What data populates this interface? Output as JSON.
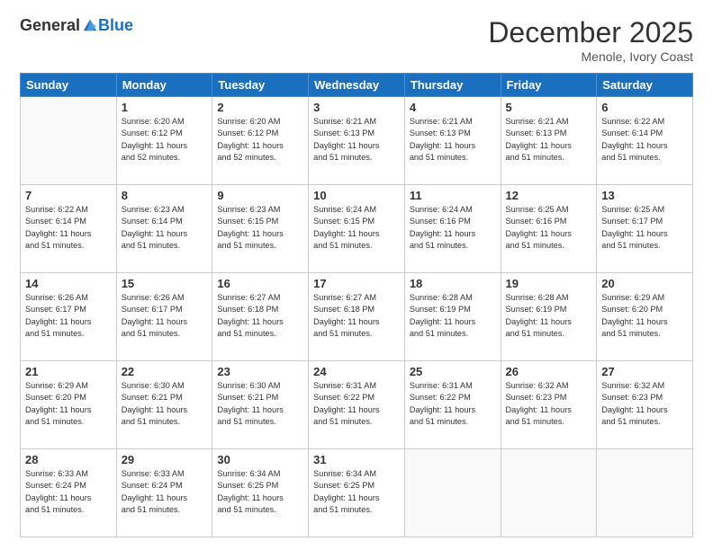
{
  "logo": {
    "general": "General",
    "blue": "Blue"
  },
  "header": {
    "month": "December 2025",
    "location": "Menole, Ivory Coast"
  },
  "weekdays": [
    "Sunday",
    "Monday",
    "Tuesday",
    "Wednesday",
    "Thursday",
    "Friday",
    "Saturday"
  ],
  "weeks": [
    [
      {
        "day": "",
        "info": ""
      },
      {
        "day": "1",
        "info": "Sunrise: 6:20 AM\nSunset: 6:12 PM\nDaylight: 11 hours\nand 52 minutes."
      },
      {
        "day": "2",
        "info": "Sunrise: 6:20 AM\nSunset: 6:12 PM\nDaylight: 11 hours\nand 52 minutes."
      },
      {
        "day": "3",
        "info": "Sunrise: 6:21 AM\nSunset: 6:13 PM\nDaylight: 11 hours\nand 51 minutes."
      },
      {
        "day": "4",
        "info": "Sunrise: 6:21 AM\nSunset: 6:13 PM\nDaylight: 11 hours\nand 51 minutes."
      },
      {
        "day": "5",
        "info": "Sunrise: 6:21 AM\nSunset: 6:13 PM\nDaylight: 11 hours\nand 51 minutes."
      },
      {
        "day": "6",
        "info": "Sunrise: 6:22 AM\nSunset: 6:14 PM\nDaylight: 11 hours\nand 51 minutes."
      }
    ],
    [
      {
        "day": "7",
        "info": "Sunrise: 6:22 AM\nSunset: 6:14 PM\nDaylight: 11 hours\nand 51 minutes."
      },
      {
        "day": "8",
        "info": "Sunrise: 6:23 AM\nSunset: 6:14 PM\nDaylight: 11 hours\nand 51 minutes."
      },
      {
        "day": "9",
        "info": "Sunrise: 6:23 AM\nSunset: 6:15 PM\nDaylight: 11 hours\nand 51 minutes."
      },
      {
        "day": "10",
        "info": "Sunrise: 6:24 AM\nSunset: 6:15 PM\nDaylight: 11 hours\nand 51 minutes."
      },
      {
        "day": "11",
        "info": "Sunrise: 6:24 AM\nSunset: 6:16 PM\nDaylight: 11 hours\nand 51 minutes."
      },
      {
        "day": "12",
        "info": "Sunrise: 6:25 AM\nSunset: 6:16 PM\nDaylight: 11 hours\nand 51 minutes."
      },
      {
        "day": "13",
        "info": "Sunrise: 6:25 AM\nSunset: 6:17 PM\nDaylight: 11 hours\nand 51 minutes."
      }
    ],
    [
      {
        "day": "14",
        "info": "Sunrise: 6:26 AM\nSunset: 6:17 PM\nDaylight: 11 hours\nand 51 minutes."
      },
      {
        "day": "15",
        "info": "Sunrise: 6:26 AM\nSunset: 6:17 PM\nDaylight: 11 hours\nand 51 minutes."
      },
      {
        "day": "16",
        "info": "Sunrise: 6:27 AM\nSunset: 6:18 PM\nDaylight: 11 hours\nand 51 minutes."
      },
      {
        "day": "17",
        "info": "Sunrise: 6:27 AM\nSunset: 6:18 PM\nDaylight: 11 hours\nand 51 minutes."
      },
      {
        "day": "18",
        "info": "Sunrise: 6:28 AM\nSunset: 6:19 PM\nDaylight: 11 hours\nand 51 minutes."
      },
      {
        "day": "19",
        "info": "Sunrise: 6:28 AM\nSunset: 6:19 PM\nDaylight: 11 hours\nand 51 minutes."
      },
      {
        "day": "20",
        "info": "Sunrise: 6:29 AM\nSunset: 6:20 PM\nDaylight: 11 hours\nand 51 minutes."
      }
    ],
    [
      {
        "day": "21",
        "info": "Sunrise: 6:29 AM\nSunset: 6:20 PM\nDaylight: 11 hours\nand 51 minutes."
      },
      {
        "day": "22",
        "info": "Sunrise: 6:30 AM\nSunset: 6:21 PM\nDaylight: 11 hours\nand 51 minutes."
      },
      {
        "day": "23",
        "info": "Sunrise: 6:30 AM\nSunset: 6:21 PM\nDaylight: 11 hours\nand 51 minutes."
      },
      {
        "day": "24",
        "info": "Sunrise: 6:31 AM\nSunset: 6:22 PM\nDaylight: 11 hours\nand 51 minutes."
      },
      {
        "day": "25",
        "info": "Sunrise: 6:31 AM\nSunset: 6:22 PM\nDaylight: 11 hours\nand 51 minutes."
      },
      {
        "day": "26",
        "info": "Sunrise: 6:32 AM\nSunset: 6:23 PM\nDaylight: 11 hours\nand 51 minutes."
      },
      {
        "day": "27",
        "info": "Sunrise: 6:32 AM\nSunset: 6:23 PM\nDaylight: 11 hours\nand 51 minutes."
      }
    ],
    [
      {
        "day": "28",
        "info": "Sunrise: 6:33 AM\nSunset: 6:24 PM\nDaylight: 11 hours\nand 51 minutes."
      },
      {
        "day": "29",
        "info": "Sunrise: 6:33 AM\nSunset: 6:24 PM\nDaylight: 11 hours\nand 51 minutes."
      },
      {
        "day": "30",
        "info": "Sunrise: 6:34 AM\nSunset: 6:25 PM\nDaylight: 11 hours\nand 51 minutes."
      },
      {
        "day": "31",
        "info": "Sunrise: 6:34 AM\nSunset: 6:25 PM\nDaylight: 11 hours\nand 51 minutes."
      },
      {
        "day": "",
        "info": ""
      },
      {
        "day": "",
        "info": ""
      },
      {
        "day": "",
        "info": ""
      }
    ]
  ]
}
